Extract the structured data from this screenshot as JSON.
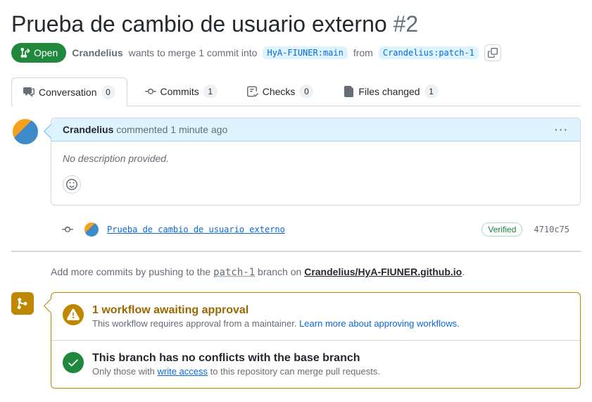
{
  "pr": {
    "title": "Prueba de cambio de usuario externo",
    "number": "#2",
    "state": "Open",
    "author": "Crandelius",
    "merge_text_1": "wants to merge 1 commit into",
    "base_ref": "HyA-FIUNER:main",
    "merge_text_2": "from",
    "head_ref": "Crandelius:patch-1"
  },
  "tabs": {
    "conversation": {
      "label": "Conversation",
      "count": "0"
    },
    "commits": {
      "label": "Commits",
      "count": "1"
    },
    "checks": {
      "label": "Checks",
      "count": "0"
    },
    "files": {
      "label": "Files changed",
      "count": "1"
    }
  },
  "comment": {
    "author": "Crandelius",
    "action": "commented 1 minute ago",
    "body": "No description provided."
  },
  "commit": {
    "message": "Prueba de cambio de usuario externo",
    "verified": "Verified",
    "sha": "4710c75"
  },
  "push_hint": {
    "prefix": "Add more commits by pushing to the",
    "branch": "patch-1",
    "middle": "branch on",
    "repo": "Crandelius/HyA-FIUNER.github.io"
  },
  "workflow": {
    "title": "1 workflow awaiting approval",
    "desc_text": "This workflow requires approval from a maintainer.",
    "learn_more": "Learn more about approving workflows."
  },
  "conflicts": {
    "title": "This branch has no conflicts with the base branch",
    "desc_prefix": "Only those with",
    "write_access": "write access",
    "desc_suffix": "to this repository can merge pull requests."
  }
}
